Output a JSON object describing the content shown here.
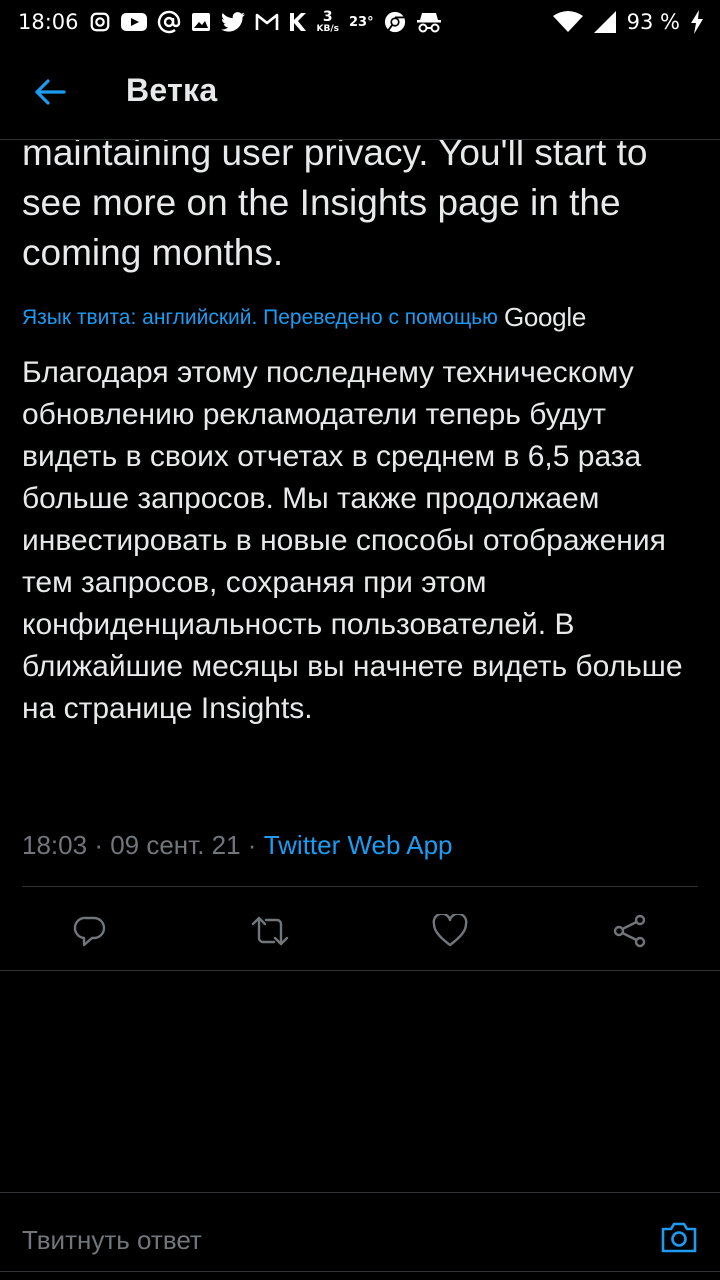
{
  "status_bar": {
    "time": "18:06",
    "net_speed_value": "3",
    "net_speed_unit": "KB/s",
    "temperature": "23°",
    "battery": "93 %"
  },
  "app_bar": {
    "title": "Ветка"
  },
  "tweet": {
    "original_text": "maintaining user privacy. You'll start to see more on the Insights page in the coming months.",
    "translation_label": "Язык твита: английский. Переведено с помощью",
    "translation_provider": "Google",
    "translated_text": "Благодаря этому последнему техническому обновлению рекламодатели теперь будут видеть в своих отчетах в среднем в 6,5 раза больше запросов. Мы также продолжаем инвестировать в новые способы отображения тем запросов, сохраняя при этом конфиденциальность пользователей. В ближайшие месяцы вы начнете видеть больше на странице Insights.",
    "time": "18:03",
    "date": "09 сент. 21",
    "source": "Twitter Web App"
  },
  "reply": {
    "placeholder": "Твитнуть ответ"
  },
  "colors": {
    "background": "#000000",
    "accent": "#1d9bf0",
    "text": "#e7e9ea",
    "muted": "#71767b",
    "divider": "#2f3336"
  }
}
